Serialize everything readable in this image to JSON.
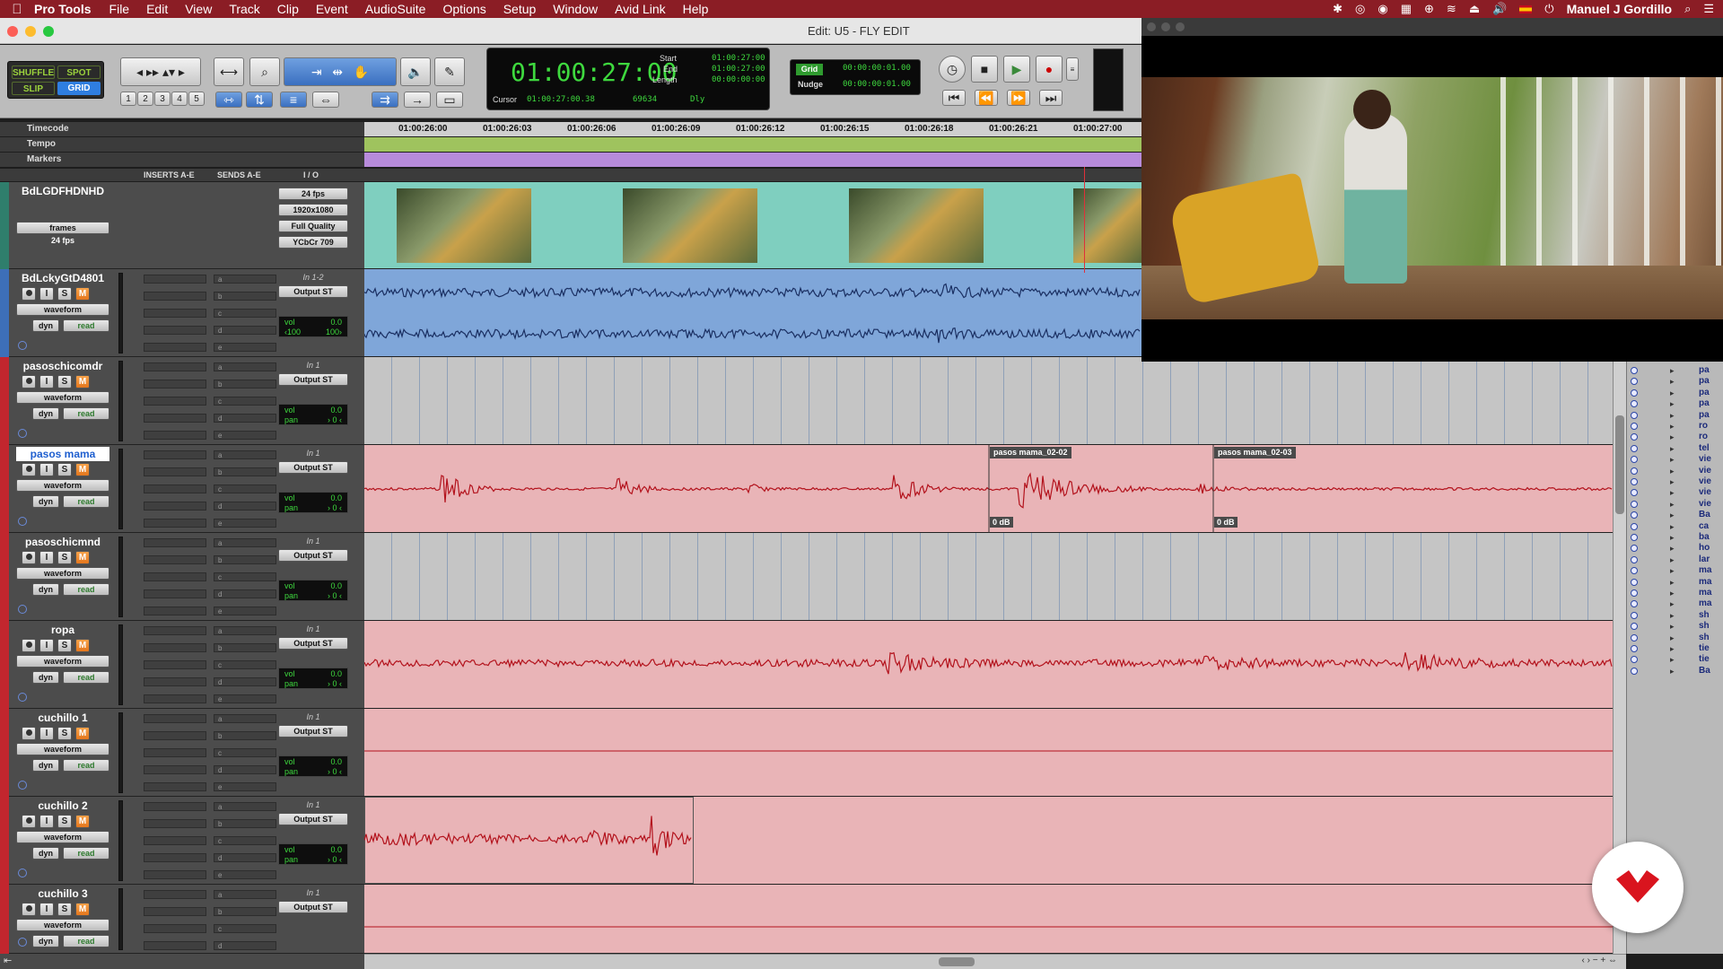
{
  "menubar": {
    "apple": "",
    "app": "Pro Tools",
    "items": [
      "File",
      "Edit",
      "View",
      "Track",
      "Clip",
      "Event",
      "AudioSuite",
      "Options",
      "Setup",
      "Window",
      "Avid Link",
      "Help"
    ],
    "user": "Manuel J Gordillo"
  },
  "window": {
    "title": "Edit: U5 - FLY EDIT"
  },
  "toolbar": {
    "modes": [
      "SHUFFLE",
      "SPOT",
      "SLIP",
      "GRID"
    ],
    "zoom_presets": [
      "1",
      "2",
      "3",
      "4",
      "5"
    ],
    "main_counter": "01:00:27:00",
    "start_label": "Start",
    "end_label": "End",
    "length_label": "Length",
    "start": "01:00:27:00",
    "end": "01:00:27:00",
    "length": "00:00:00:00",
    "cursor_label": "Cursor",
    "cursor": "01:00:27:00.38",
    "sample_value": "69634",
    "dly": "Dly",
    "grid_label": "Grid",
    "grid_value": "00:00:00:01.00",
    "nudge_label": "Nudge",
    "nudge_value": "00:00:00:01.00"
  },
  "rulers": {
    "timecode_label": "Timecode",
    "tempo_label": "Tempo",
    "markers_label": "Markers",
    "ticks": [
      "01:00:26:00",
      "01:00:26:03",
      "01:00:26:06",
      "01:00:26:09",
      "01:00:26:12",
      "01:00:26:15",
      "01:00:26:18",
      "01:00:26:21",
      "01:00:27:00"
    ]
  },
  "columns": {
    "inserts": "INSERTS A-E",
    "sends": "SENDS A-E",
    "io": "I / O"
  },
  "video_track": {
    "name": "BdLGDFHDNHD",
    "frames": "frames",
    "fps_label": "24 fps",
    "io": [
      "24 fps",
      "1920x1080",
      "Full Quality",
      "YCbCr 709"
    ]
  },
  "tracks": [
    {
      "name": "BdLckyGtD4801",
      "input": "In 1-2",
      "output": "Output ST",
      "view": "waveform",
      "mode": "read",
      "vol_label": "vol",
      "vol": "0.0",
      "pan_label": "",
      "pan": "",
      "pan_l": "‹100",
      "pan_r": "100›",
      "stereo": true
    },
    {
      "name": "pasoschicomdr",
      "input": "In 1",
      "output": "Output ST",
      "view": "waveform",
      "mode": "read",
      "vol_label": "vol",
      "vol": "0.0",
      "pan_label": "pan",
      "pan": "› 0 ‹"
    },
    {
      "name": "pasos mama",
      "input": "In 1",
      "output": "Output ST",
      "view": "waveform",
      "mode": "read",
      "vol_label": "vol",
      "vol": "0.0",
      "pan_label": "pan",
      "pan": "› 0 ‹",
      "selected": true
    },
    {
      "name": "pasoschicmnd",
      "input": "In 1",
      "output": "Output ST",
      "view": "waveform",
      "mode": "read",
      "vol_label": "vol",
      "vol": "0.0",
      "pan_label": "pan",
      "pan": "› 0 ‹"
    },
    {
      "name": "ropa",
      "input": "In 1",
      "output": "Output ST",
      "view": "waveform",
      "mode": "read",
      "vol_label": "vol",
      "vol": "0.0",
      "pan_label": "pan",
      "pan": "› 0 ‹"
    },
    {
      "name": "cuchillo 1",
      "input": "In 1",
      "output": "Output ST",
      "view": "waveform",
      "mode": "read",
      "vol_label": "vol",
      "vol": "0.0",
      "pan_label": "pan",
      "pan": "› 0 ‹"
    },
    {
      "name": "cuchillo 2",
      "input": "In 1",
      "output": "Output ST",
      "view": "waveform",
      "mode": "read",
      "vol_label": "vol",
      "vol": "0.0",
      "pan_label": "pan",
      "pan": "› 0 ‹"
    },
    {
      "name": "cuchillo 3",
      "input": "In 1",
      "output": "Output ST",
      "view": "waveform",
      "mode": "read",
      "vol_label": "vol",
      "vol": "0.0",
      "pan_label": "pan",
      "pan": "› 0 ‹"
    }
  ],
  "track_buttons": {
    "solo_safe": "I",
    "solo": "S",
    "mute": "M",
    "dyn": "dyn"
  },
  "send_letters": [
    "a",
    "b",
    "c",
    "d",
    "e"
  ],
  "clips": {
    "clip1": "pasos mama_02-02",
    "clip2": "pasos mama_02-03",
    "gain1": "0 dB",
    "gain2": "0 dB"
  },
  "cliplist_items": [
    "pa",
    "pa",
    "pa",
    "pa",
    "pa",
    "ro",
    "ro",
    "tel",
    "vie",
    "vie",
    "vie",
    "vie",
    "vie",
    "Ba",
    "ca",
    "ba",
    "ho",
    "lar",
    "ma",
    "ma",
    "ma",
    "ma",
    "sh",
    "sh",
    "sh",
    "tie",
    "tie",
    "Ba"
  ],
  "colors": {
    "menubar": "#8b1d25",
    "audio_stereo": "#7fa6d9",
    "audio_mono": "#e9b4b7",
    "waveform_red": "#b3121c",
    "waveform_blue": "#1a2f62",
    "video_track": "#7fcfbf",
    "tempo": "#9fc35e",
    "markers": "#b78bdb"
  }
}
